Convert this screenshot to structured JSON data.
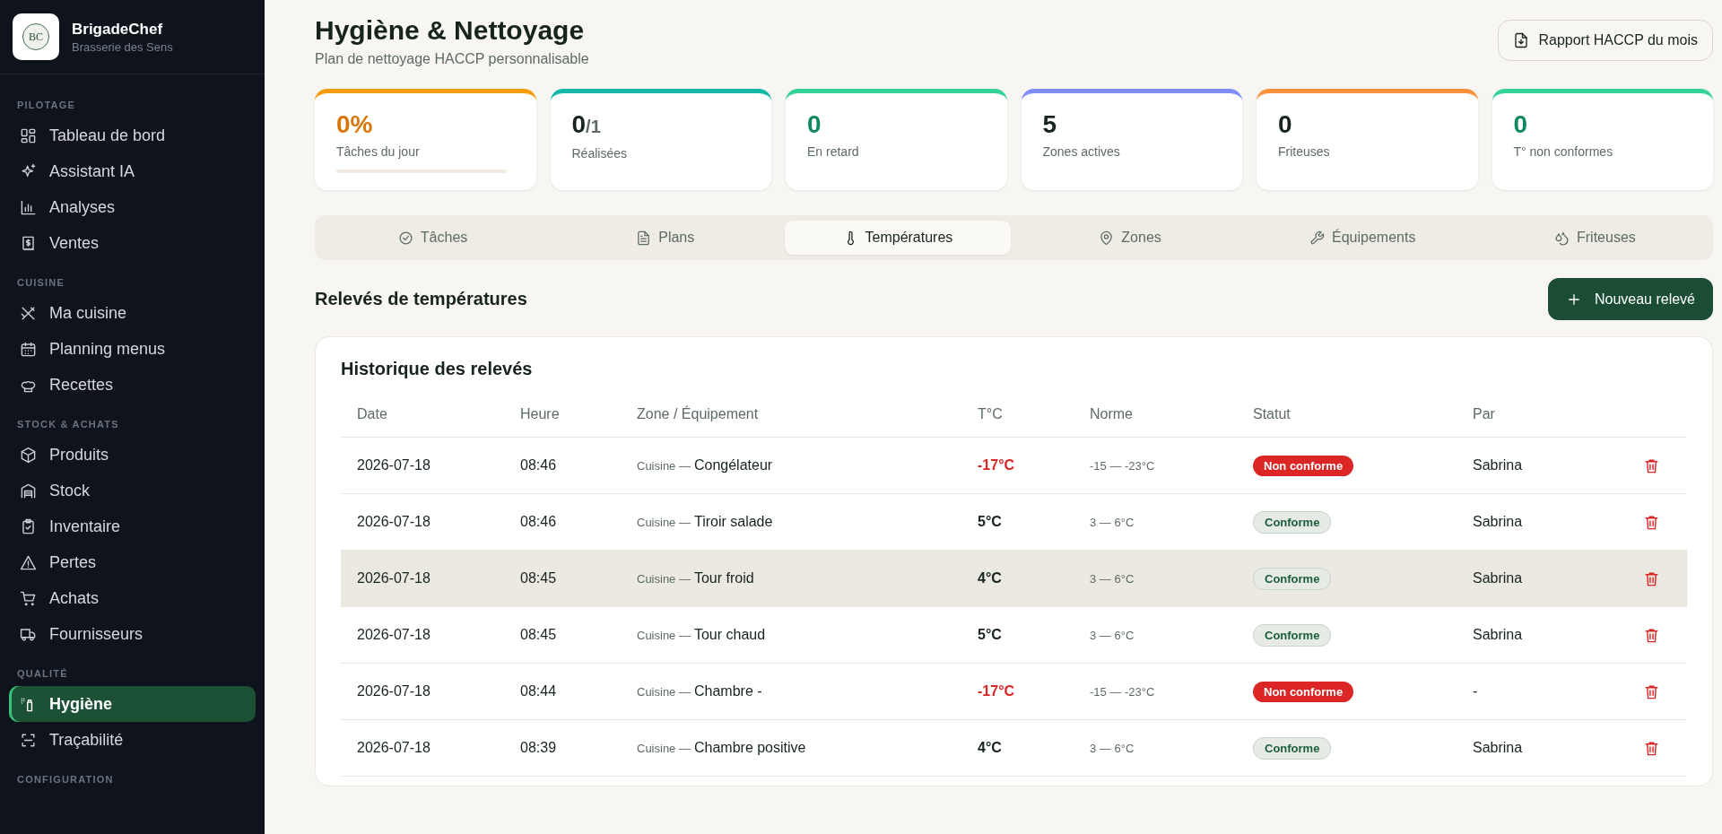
{
  "sidebar": {
    "brand": {
      "logo_text": "BC",
      "name": "BrigadeChef",
      "subtitle": "Brasserie des Sens"
    },
    "sections": [
      {
        "label": "PILOTAGE",
        "items": [
          {
            "label": "Tableau de bord",
            "selected": false
          },
          {
            "label": "Assistant IA",
            "selected": false
          },
          {
            "label": "Analyses",
            "selected": false
          },
          {
            "label": "Ventes",
            "selected": false
          }
        ]
      },
      {
        "label": "CUISINE",
        "items": [
          {
            "label": "Ma cuisine",
            "selected": false
          },
          {
            "label": "Planning menus",
            "selected": false
          },
          {
            "label": "Recettes",
            "selected": false
          }
        ]
      },
      {
        "label": "STOCK & ACHATS",
        "items": [
          {
            "label": "Produits",
            "selected": false
          },
          {
            "label": "Stock",
            "selected": false
          },
          {
            "label": "Inventaire",
            "selected": false
          },
          {
            "label": "Pertes",
            "selected": false
          },
          {
            "label": "Achats",
            "selected": false
          },
          {
            "label": "Fournisseurs",
            "selected": false
          }
        ]
      },
      {
        "label": "QUALITÉ",
        "items": [
          {
            "label": "Hygiène",
            "selected": true
          },
          {
            "label": "Traçabilité",
            "selected": false
          }
        ]
      },
      {
        "label": "CONFIGURATION"
      }
    ]
  },
  "header": {
    "title": "Hygiène & Nettoyage",
    "subtitle": "Plan de nettoyage HACCP personnalisable",
    "report_button": "Rapport HACCP du mois"
  },
  "stats": [
    {
      "value": "0%",
      "label": "Tâches du jour",
      "color": "#f59e0b",
      "kind": "warning",
      "level": 0
    },
    {
      "value": "0",
      "suffix": "/1",
      "label": "Réalisées",
      "color": "#14b8a6",
      "kind": "neutral"
    },
    {
      "value": "0",
      "label": "En retard",
      "color": "#34d399",
      "kind": "success"
    },
    {
      "value": "5",
      "label": "Zones actives",
      "color": "#818cf8",
      "kind": "neutral"
    },
    {
      "value": "0",
      "label": "Friteuses",
      "color": "#fb923c",
      "kind": "neutral"
    },
    {
      "value": "0",
      "label": "T° non conformes",
      "color": "#34d399",
      "kind": "success"
    }
  ],
  "tabs": [
    {
      "label": "Tâches",
      "selected": false
    },
    {
      "label": "Plans",
      "selected": false
    },
    {
      "label": "Températures",
      "selected": true
    },
    {
      "label": "Zones",
      "selected": false
    },
    {
      "label": "Équipements",
      "selected": false
    },
    {
      "label": "Friteuses",
      "selected": false
    }
  ],
  "readings": {
    "title": "Relevés de températures",
    "new_button": "Nouveau relevé",
    "history": {
      "title": "Historique des relevés",
      "columns": [
        "Date",
        "Heure",
        "Zone / Équipement",
        "T°C",
        "Norme",
        "Statut",
        "Par"
      ],
      "rows": [
        {
          "date": "2026-07-18",
          "time": "08:46",
          "zone": "Cuisine —",
          "equipment": "Congélateur",
          "temperature": "-17°C",
          "norm": "-15 — -23°C",
          "status": {
            "label": "Non conforme",
            "kind": "alert"
          },
          "by": "Sabrina",
          "selected": false
        },
        {
          "date": "2026-07-18",
          "time": "08:46",
          "zone": "Cuisine —",
          "equipment": "Tiroir salade",
          "temperature": "5°C",
          "norm": "3 — 6°C",
          "status": {
            "label": "Conforme",
            "kind": "ok"
          },
          "by": "Sabrina",
          "selected": false
        },
        {
          "date": "2026-07-18",
          "time": "08:45",
          "zone": "Cuisine —",
          "equipment": "Tour froid",
          "temperature": "4°C",
          "norm": "3 — 6°C",
          "status": {
            "label": "Conforme",
            "kind": "ok"
          },
          "by": "Sabrina",
          "selected": true
        },
        {
          "date": "2026-07-18",
          "time": "08:45",
          "zone": "Cuisine —",
          "equipment": "Tour chaud",
          "temperature": "5°C",
          "norm": "3 — 6°C",
          "status": {
            "label": "Conforme",
            "kind": "ok"
          },
          "by": "Sabrina",
          "selected": false
        },
        {
          "date": "2026-07-18",
          "time": "08:44",
          "zone": "Cuisine —",
          "equipment": "Chambre -",
          "temperature": "-17°C",
          "norm": "-15 — -23°C",
          "status": {
            "label": "Non conforme",
            "kind": "alert"
          },
          "by": "-",
          "selected": false
        },
        {
          "date": "2026-07-18",
          "time": "08:39",
          "zone": "Cuisine —",
          "equipment": "Chambre positive",
          "temperature": "4°C",
          "norm": "3 — 6°C",
          "status": {
            "label": "Conforme",
            "kind": "ok"
          },
          "by": "Sabrina",
          "selected": false
        }
      ]
    }
  }
}
